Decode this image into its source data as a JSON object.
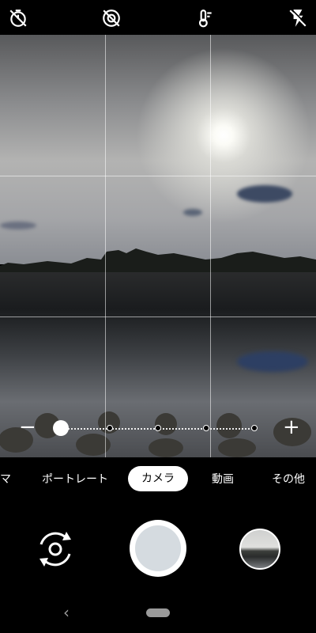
{
  "top_bar": {
    "icons": [
      "timer-off-icon",
      "motion-off-icon",
      "white-balance-icon",
      "flash-off-icon"
    ]
  },
  "zoom": {
    "minus_label": "−",
    "plus_label": "+",
    "level_fraction": 0
  },
  "modes": {
    "items": [
      "マ",
      "ポートレート",
      "カメラ",
      "動画",
      "その他"
    ],
    "active": "カメラ"
  },
  "bottom_controls": {
    "switch_camera_icon": "switch-camera-icon",
    "shutter_icon": "shutter-button",
    "thumbnail_icon": "gallery-thumbnail"
  },
  "nav": {
    "back_glyph": "‹"
  }
}
